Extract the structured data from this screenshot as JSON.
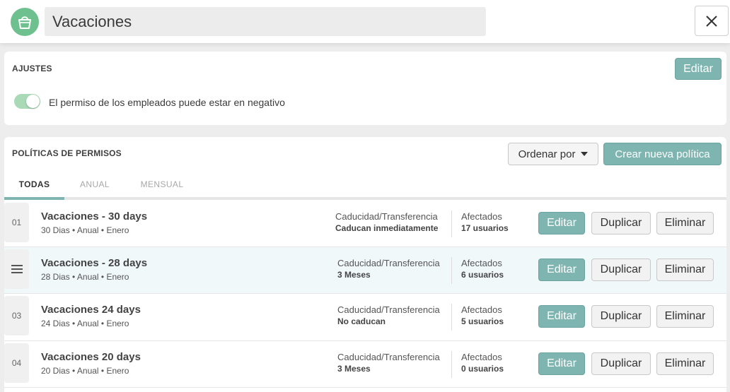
{
  "header": {
    "title": "Vacaciones",
    "logo_icon": "shopping-bag-icon",
    "close_icon": "close-icon"
  },
  "settings": {
    "title": "AJUSTES",
    "edit_label": "Editar",
    "toggle_label": "El permiso de los empleados puede estar en negativo",
    "toggle_on": true
  },
  "policies": {
    "title": "POLÍTICAS DE PERMISOS",
    "sort_label": "Ordenar por",
    "create_label": "Crear nueva política",
    "tabs": [
      {
        "label": "TODAS",
        "active": true
      },
      {
        "label": "ANUAL",
        "active": false
      },
      {
        "label": "MENSUAL",
        "active": false
      }
    ],
    "rows": [
      {
        "number": "01",
        "title": "Vacaciones - 30 days",
        "subtitle": "30 Dias • Anual • Enero",
        "expiry_label": "Caducidad/Transferencia",
        "expiry_value": "Caducan inmediatamente",
        "affected_label": "Afectados",
        "affected_value": "17 usuarios"
      },
      {
        "number": "",
        "title": "Vacaciones - 28 days",
        "subtitle": "28 Dias • Anual • Enero",
        "expiry_label": "Caducidad/Transferencia",
        "expiry_value": "3 Meses",
        "affected_label": "Afectados",
        "affected_value": "6 usuarios"
      },
      {
        "number": "03",
        "title": "Vacaciones 24 days",
        "subtitle": "24 Dias • Anual • Enero",
        "expiry_label": "Caducidad/Transferencia",
        "expiry_value": "No caducan",
        "affected_label": "Afectados",
        "affected_value": "5 usuarios"
      },
      {
        "number": "04",
        "title": "Vacaciones 20 days",
        "subtitle": "20 Dias • Anual • Enero",
        "expiry_label": "Caducidad/Transferencia",
        "expiry_value": "3 Meses",
        "affected_label": "Afectados",
        "affected_value": "0 usuarios"
      }
    ],
    "row_actions": {
      "edit": "Editar",
      "duplicate": "Duplicar",
      "delete": "Eliminar"
    }
  },
  "colors": {
    "accent": "#7fb5b1",
    "logo": "#6fc08f",
    "toggle": "#a9d9b6",
    "row_highlight": "#f1f8fa"
  }
}
